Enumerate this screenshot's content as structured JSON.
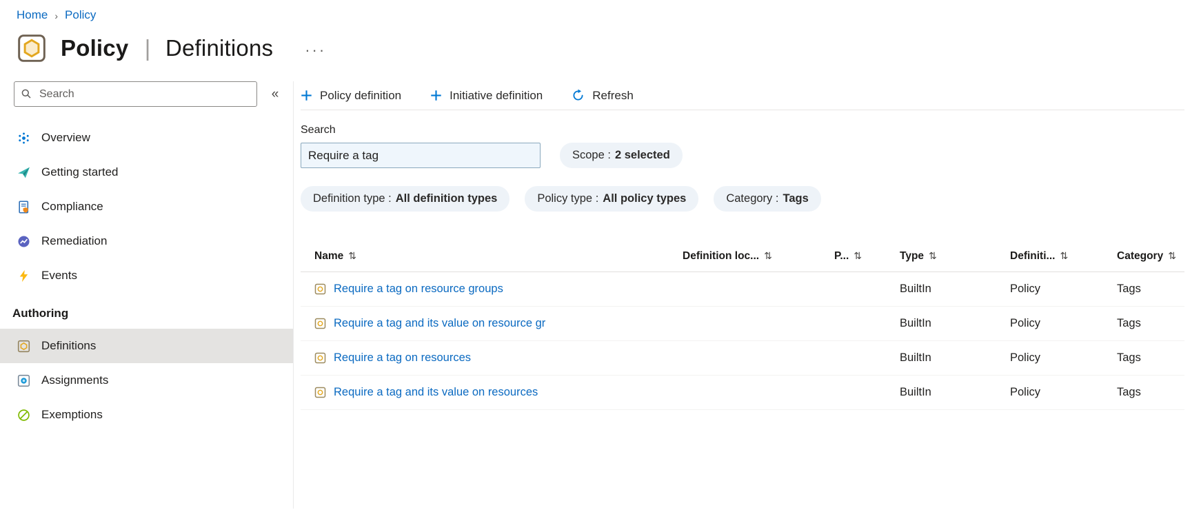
{
  "icons": {
    "sort": "⇅",
    "breadcrumb_separator": "›",
    "collapse": "«",
    "more": "···"
  },
  "breadcrumb": {
    "items": [
      {
        "label": "Home"
      },
      {
        "label": "Policy"
      }
    ]
  },
  "header": {
    "title_primary": "Policy",
    "title_separator": "|",
    "title_secondary": "Definitions"
  },
  "sidebar": {
    "search_placeholder": "Search",
    "items": [
      {
        "label": "Overview"
      },
      {
        "label": "Getting started"
      },
      {
        "label": "Compliance"
      },
      {
        "label": "Remediation"
      },
      {
        "label": "Events"
      }
    ],
    "section_label": "Authoring",
    "authoring_items": [
      {
        "label": "Definitions",
        "selected": true
      },
      {
        "label": "Assignments",
        "selected": false
      },
      {
        "label": "Exemptions",
        "selected": false
      }
    ]
  },
  "toolbar": {
    "buttons": [
      {
        "label": "Policy definition"
      },
      {
        "label": "Initiative definition"
      },
      {
        "label": "Refresh"
      }
    ]
  },
  "filters": {
    "search_label": "Search",
    "search_value": "Require a tag",
    "pills": [
      {
        "name": "Scope :",
        "value": "2 selected"
      },
      {
        "name": "Definition type :",
        "value": "All definition types"
      },
      {
        "name": "Policy type :",
        "value": "All policy types"
      },
      {
        "name": "Category :",
        "value": "Tags"
      }
    ]
  },
  "table": {
    "columns": [
      {
        "label": "Name"
      },
      {
        "label": "Definition loc..."
      },
      {
        "label": "P..."
      },
      {
        "label": "Type"
      },
      {
        "label": "Definiti..."
      },
      {
        "label": "Category"
      }
    ],
    "rows": [
      {
        "name": "Require a tag on resource groups",
        "type": "BuiltIn",
        "definition_type": "Policy",
        "category": "Tags"
      },
      {
        "name": "Require a tag and its value on resource gr",
        "type": "BuiltIn",
        "definition_type": "Policy",
        "category": "Tags"
      },
      {
        "name": "Require a tag on resources",
        "type": "BuiltIn",
        "definition_type": "Policy",
        "category": "Tags"
      },
      {
        "name": "Require a tag and its value on resources",
        "type": "BuiltIn",
        "definition_type": "Policy",
        "category": "Tags"
      }
    ]
  }
}
